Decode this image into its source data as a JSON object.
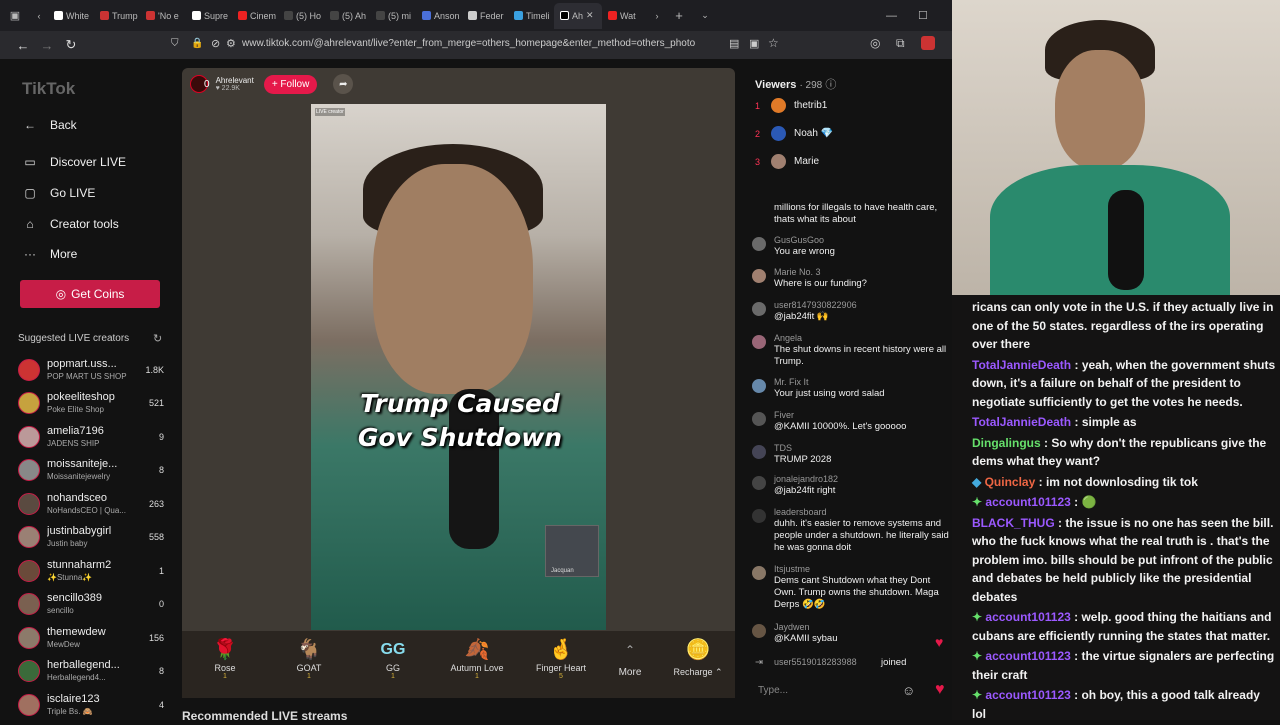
{
  "tabs": [
    {
      "label": "White"
    },
    {
      "label": "Trump"
    },
    {
      "label": "'No e"
    },
    {
      "label": "Supre"
    },
    {
      "label": "Cinem"
    },
    {
      "label": "(5) Ho"
    },
    {
      "label": "(5) Ah"
    },
    {
      "label": "(5) mi"
    },
    {
      "label": "Anson"
    },
    {
      "label": "Feder"
    },
    {
      "label": "Timeli"
    },
    {
      "label": "Ah"
    },
    {
      "label": "Wat"
    }
  ],
  "browser": {
    "url": "www.tiktok.com/@ahrelevant/live?enter_from_merge=others_homepage&enter_method=others_photo"
  },
  "sidebar": {
    "logo": "TikTok",
    "back": "Back",
    "nav": [
      {
        "label": "Discover LIVE"
      },
      {
        "label": "Go LIVE"
      },
      {
        "label": "Creator tools"
      },
      {
        "label": "More"
      }
    ],
    "coins": "Get Coins",
    "suggested_title": "Suggested LIVE creators",
    "creators": [
      {
        "name": "popmart.uss...",
        "sub": "POP MART US SHOP",
        "count": "1.8K"
      },
      {
        "name": "pokeeliteshop",
        "sub": "Poke Elite Shop",
        "count": "521"
      },
      {
        "name": "amelia7196",
        "sub": "JADENS SHIP",
        "count": "9"
      },
      {
        "name": "moissaniteje...",
        "sub": "Moissanitejewelry",
        "count": "8"
      },
      {
        "name": "nohandsceo",
        "sub": "NoHandsCEO | Qua...",
        "count": "263"
      },
      {
        "name": "justinbabygirl",
        "sub": "Justin baby",
        "count": "558"
      },
      {
        "name": "stunnaharm2",
        "sub": "✨Stunna✨",
        "count": "1"
      },
      {
        "name": "sencillo389",
        "sub": "sencillo",
        "count": "0"
      },
      {
        "name": "themewdew",
        "sub": "MewDew",
        "count": "156"
      },
      {
        "name": "herballegend...",
        "sub": "Herballegend4...",
        "count": "8"
      },
      {
        "name": "isclaire123",
        "sub": "Triple Bs. 🙈",
        "count": "4"
      }
    ]
  },
  "live": {
    "host_name": "Ahrelevant",
    "host_likes": "22.9K",
    "host_badge": "0",
    "follow": "+ Follow",
    "caption_line1": "Trump Caused",
    "caption_line2": "Gov Shutdown",
    "pip_name": "Jacquan",
    "watermark": "LIVE creator"
  },
  "gifts": [
    {
      "icon": "🌹",
      "label": "Rose",
      "cost": "1"
    },
    {
      "icon": "🐐",
      "label": "GOAT",
      "cost": "1"
    },
    {
      "icon": "GG",
      "label": "GG",
      "cost": "1"
    },
    {
      "icon": "🍂",
      "label": "Autumn Love",
      "cost": "1"
    },
    {
      "icon": "🤞",
      "label": "Finger Heart",
      "cost": "5"
    },
    {
      "icon": "⌃",
      "label": "More",
      "cost": ""
    },
    {
      "icon": "🪙",
      "label": "Recharge ⌃",
      "cost": ""
    }
  ],
  "recommended": "Recommended LIVE streams",
  "viewers": {
    "title": "Viewers",
    "count": "· 298",
    "top": [
      {
        "rank": "1",
        "name": "thetrib1",
        "color": "#e07a28"
      },
      {
        "rank": "2",
        "name": "Noah 💎",
        "color": "#2b59b5"
      },
      {
        "rank": "3",
        "name": "Marie",
        "color": "#a08070"
      }
    ]
  },
  "chat": [
    {
      "user": "",
      "text": "millions for illegals to have health care, thats what its about"
    },
    {
      "user": "GusGusGoo",
      "text": "You are wrong"
    },
    {
      "user": "Marie  No. 3",
      "text": "Where is our funding?"
    },
    {
      "user": "user8147930822906",
      "text": "@jab24fit 🙌"
    },
    {
      "user": "Angela",
      "text": "The shut downs in recent history were all Trump."
    },
    {
      "user": "Mr. Fix It",
      "text": "Your just using word salad"
    },
    {
      "user": "Fiver",
      "text": "@KAMII 10000%. Let's gooooo"
    },
    {
      "user": "TDS",
      "text": "TRUMP 2028"
    },
    {
      "user": "jonalejandro182",
      "text": "@jab24fit right"
    },
    {
      "user": "leadersboard",
      "text": "duhh. it's easier to remove systems and people under a shutdown. he literally said he was gonna doit"
    },
    {
      "user": "Itsjustme",
      "text": "Dems cant Shutdown what they Dont Own. Trump owns the shutdown. Maga Derps 🤣🤣"
    },
    {
      "user": "Jaydwen",
      "text": "@KAMII sybau"
    }
  ],
  "joined": {
    "user": "user5519018283988",
    "text": "joined"
  },
  "type_placeholder": "Type...",
  "stream_chat": [
    {
      "user": "",
      "text": "ricans can only vote in the U.S. if they actually live in one of the 50 states. regardless of the irs operating over there",
      "color": ""
    },
    {
      "user": "TotalJannieDeath",
      "text": ": yeah, when the government shuts down, it's a failure on behalf of the president to negotiate sufficiently to get the votes he needs.",
      "color": "#9b59ff"
    },
    {
      "user": "TotalJannieDeath",
      "text": ": simple as",
      "color": "#9b59ff"
    },
    {
      "user": "Dingalingus",
      "text": ": So why don't the republicans give the dems what they want?",
      "color": "#66e06b"
    },
    {
      "user": "Quinclay",
      "text": ": im not downlosding tik tok",
      "color": "#e64"
    },
    {
      "user": "account101123",
      "text": ": 🟢",
      "color": "#9b59ff"
    },
    {
      "user": "BLACK_THUG",
      "text": ": the issue is no one has seen the bill. who the fuck knows what the real truth is . that's the problem imo. bills should be put infront of the public and debates be held publicly like the presidential debates",
      "color": "#9b59ff"
    },
    {
      "user": "account101123",
      "text": ": welp. good thing the haitians and cubans are efficiently running the states that matter.",
      "color": "#9b59ff"
    },
    {
      "user": "account101123",
      "text": ": the virtue signalers are perfecting their craft",
      "color": "#9b59ff"
    },
    {
      "user": "account101123",
      "text": ": oh boy, this a good talk already lol",
      "color": "#9b59ff"
    }
  ]
}
